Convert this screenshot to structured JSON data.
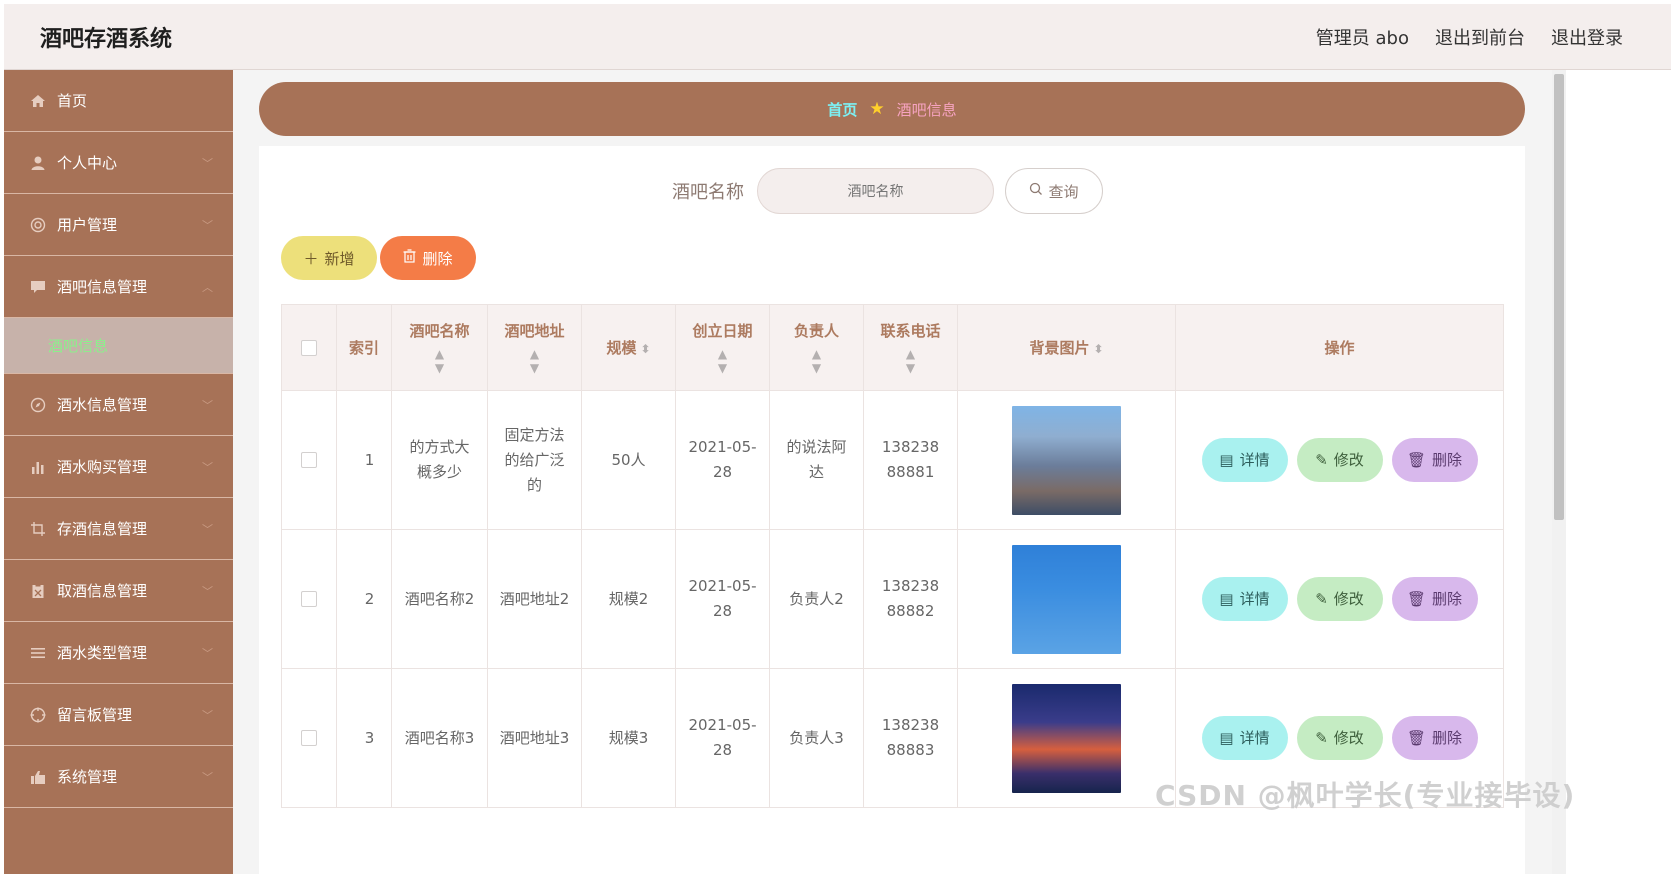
{
  "header": {
    "app_title": "酒吧存酒系统",
    "admin_label": "管理员 abo",
    "to_front_label": "退出到前台",
    "logout_label": "退出登录"
  },
  "sidebar": {
    "items": [
      {
        "label": "首页",
        "icon": "home-icon"
      },
      {
        "label": "个人中心",
        "icon": "user-icon"
      },
      {
        "label": "用户管理",
        "icon": "users-icon"
      },
      {
        "label": "酒吧信息管理",
        "icon": "message-icon",
        "expanded": true
      },
      {
        "label": "酒水信息管理",
        "icon": "compass-icon"
      },
      {
        "label": "酒水购买管理",
        "icon": "bar-chart-icon"
      },
      {
        "label": "存酒信息管理",
        "icon": "crop-icon"
      },
      {
        "label": "取酒信息管理",
        "icon": "clipboard-icon"
      },
      {
        "label": "酒水类型管理",
        "icon": "list-icon"
      },
      {
        "label": "留言板管理",
        "icon": "aim-icon"
      },
      {
        "label": "系统管理",
        "icon": "thumb-icon"
      }
    ],
    "submenu": {
      "label": "酒吧信息"
    }
  },
  "breadcrumb": {
    "home": "首页",
    "current": "酒吧信息"
  },
  "search": {
    "label": "酒吧名称",
    "placeholder": "酒吧名称",
    "button_label": "查询"
  },
  "actions": {
    "add_label": "新增",
    "delete_label": "删除"
  },
  "table": {
    "headers": {
      "index": "索引",
      "name": "酒吧名称",
      "address": "酒吧地址",
      "scale": "规模",
      "date": "创立日期",
      "manager": "负责人",
      "phone": "联系电话",
      "image": "背景图片",
      "ops": "操作"
    },
    "rows": [
      {
        "index": "1",
        "name": "的方式大概多少",
        "address": "固定方法的给广泛的",
        "scale": "50人",
        "date": "2021-05-28",
        "manager": "的说法阿达",
        "phone": "13823888881",
        "image": "city-skyline"
      },
      {
        "index": "2",
        "name": "酒吧名称2",
        "address": "酒吧地址2",
        "scale": "规模2",
        "date": "2021-05-28",
        "manager": "负责人2",
        "phone": "13823888882",
        "image": "weather-screenshot"
      },
      {
        "index": "3",
        "name": "酒吧名称3",
        "address": "酒吧地址3",
        "scale": "规模3",
        "date": "2021-05-28",
        "manager": "负责人3",
        "phone": "13823888883",
        "image": "night-city"
      }
    ],
    "row_actions": {
      "detail": "详情",
      "edit": "修改",
      "delete": "删除"
    }
  },
  "watermark": "CSDN @枫叶学长(专业接毕设)",
  "colors": {
    "sidebar_bg": "#a77257",
    "submenu_bg": "#c7b2aa",
    "submenu_text": "#8cf08c",
    "breadcrumb_home": "#7df0f3",
    "add_button": "#ede07b",
    "delete_button": "#f47c47",
    "detail_button": "#a9f1ef",
    "edit_button": "#c5ecc3",
    "row_delete_button": "#d8b8ec"
  }
}
